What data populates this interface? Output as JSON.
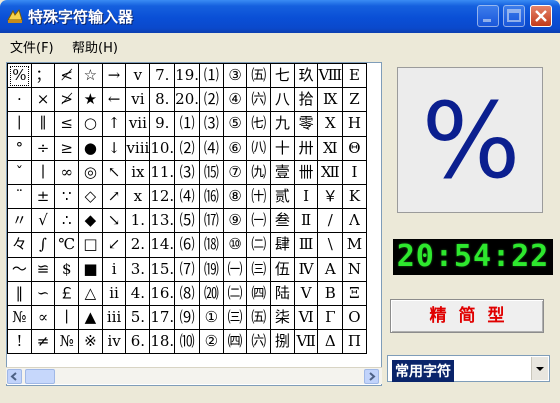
{
  "window": {
    "title": "特殊字符输入器"
  },
  "menu": {
    "items": [
      {
        "label": "文件(F)"
      },
      {
        "label": "帮助(H)"
      }
    ]
  },
  "grid": {
    "rows": [
      [
        "%",
        "；",
        "≮",
        "☆",
        "→",
        "v",
        "7.",
        "19.",
        "⑴",
        "③",
        "㈤",
        "七",
        "玖",
        "Ⅷ",
        "Ε"
      ],
      [
        "·",
        "×",
        "≯",
        "★",
        "←",
        "vi",
        "8.",
        "20.",
        "⑵",
        "④",
        "㈥",
        "八",
        "拾",
        "Ⅸ",
        "Ζ"
      ],
      [
        "∣",
        "∥",
        "≤",
        "○",
        "↑",
        "vii",
        "9.",
        "⑴",
        "⑶",
        "⑤",
        "㈦",
        "九",
        "零",
        "Ⅹ",
        "Η"
      ],
      [
        "°",
        "÷",
        "≥",
        "●",
        "↓",
        "viii",
        "10.",
        "⑵",
        "⑷",
        "⑥",
        "㈧",
        "十",
        "卅",
        "Ⅺ",
        "Θ"
      ],
      [
        "ˇ",
        "∣",
        "∞",
        "◎",
        "↖",
        "ix",
        "11.",
        "⑶",
        "⒂",
        "⑦",
        "㈨",
        "壹",
        "卌",
        "Ⅻ",
        "Ι"
      ],
      [
        "¨",
        "±",
        "∵",
        "◇",
        "↗",
        "x",
        "12.",
        "⑷",
        "⒃",
        "⑧",
        "㈩",
        "贰",
        "Ⅰ",
        "￥",
        "Κ"
      ],
      [
        "〃",
        "√",
        "∴",
        "◆",
        "↘",
        "1.",
        "13.",
        "⑸",
        "⒄",
        "⑨",
        "㈠",
        "叁",
        "Ⅱ",
        "/",
        "Λ"
      ],
      [
        "々",
        "∫",
        "℃",
        "□",
        "↙",
        "2.",
        "14.",
        "⑹",
        "⒅",
        "⑩",
        "㈡",
        "肆",
        "Ⅲ",
        "\\",
        "Μ"
      ],
      [
        "～",
        "≌",
        "$",
        "■",
        "ⅰ",
        "3.",
        "15.",
        "⑺",
        "⒆",
        "㈠",
        "㈢",
        "伍",
        "Ⅳ",
        "Α",
        "Ν"
      ],
      [
        "‖",
        "∽",
        "￡",
        "△",
        "ⅱ",
        "4.",
        "16.",
        "⑻",
        "⒇",
        "㈡",
        "㈣",
        "陆",
        "Ⅴ",
        "Β",
        "Ξ"
      ],
      [
        "№",
        "∝",
        "∣",
        "▲",
        "ⅲ",
        "5.",
        "17.",
        "⑼",
        "①",
        "㈢",
        "㈤",
        "柒",
        "Ⅵ",
        "Γ",
        "Ο"
      ],
      [
        "!",
        "≠",
        "№",
        "※",
        "ⅳ",
        "6.",
        "18.",
        "⑽",
        "②",
        "㈣",
        "㈥",
        "捌",
        "Ⅶ",
        "Δ",
        "Π"
      ]
    ]
  },
  "preview": {
    "char": "%"
  },
  "clock": {
    "time": "20:54:22"
  },
  "mode_button": {
    "label": "精简型"
  },
  "category_select": {
    "selected": "常用字符"
  }
}
